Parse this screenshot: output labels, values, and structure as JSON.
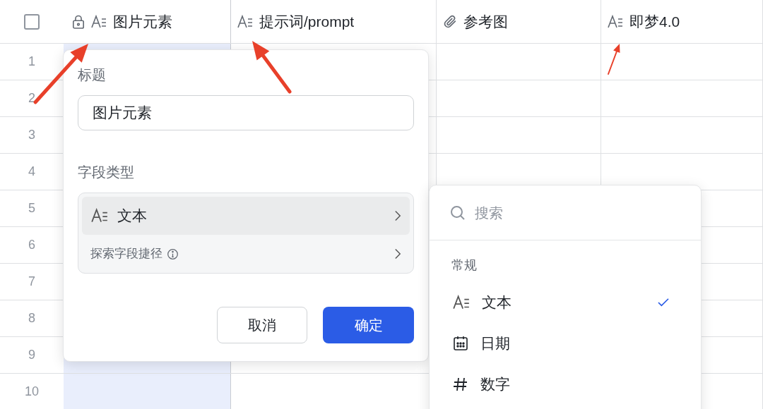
{
  "select_all": {
    "checked": false
  },
  "columns": [
    {
      "kind": "text",
      "label": "图片元素",
      "locked": true,
      "selected": true
    },
    {
      "kind": "text",
      "label": "提示词/prompt",
      "locked": false,
      "selected": false
    },
    {
      "kind": "attachment",
      "label": "参考图",
      "locked": false,
      "selected": false
    },
    {
      "kind": "text",
      "label": "即梦4.0",
      "locked": false,
      "selected": false
    }
  ],
  "rows": [
    {
      "number": "1"
    },
    {
      "number": "2"
    },
    {
      "number": "3"
    },
    {
      "number": "4"
    },
    {
      "number": "5"
    },
    {
      "number": "6"
    },
    {
      "number": "7"
    },
    {
      "number": "8"
    },
    {
      "number": "9"
    },
    {
      "number": "10"
    }
  ],
  "field_dialog": {
    "title_label": "标题",
    "title_value": "图片元素",
    "type_label": "字段类型",
    "type_value": {
      "kind": "text",
      "label": "文本"
    },
    "shortcut": "探索字段捷径",
    "cancel": "取消",
    "confirm": "确定"
  },
  "type_menu": {
    "search_placeholder": "搜索",
    "section": "常规",
    "items": [
      {
        "kind": "text",
        "label": "文本",
        "selected": true
      },
      {
        "kind": "date",
        "label": "日期",
        "selected": false
      },
      {
        "kind": "number",
        "label": "数字",
        "selected": false
      }
    ]
  }
}
